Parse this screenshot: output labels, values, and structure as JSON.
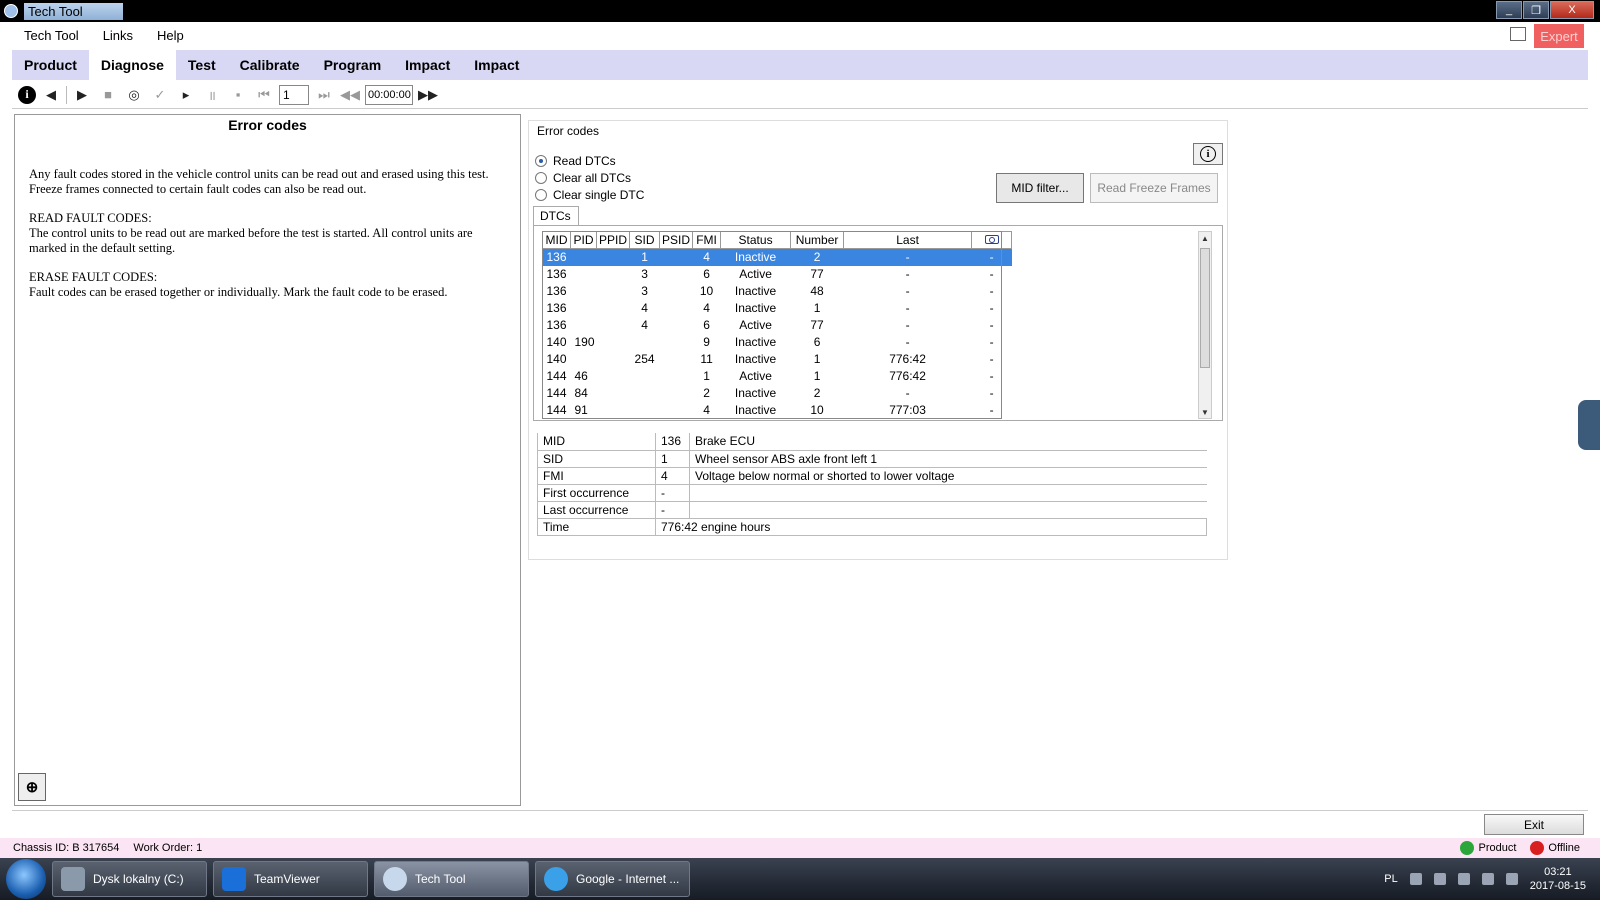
{
  "window": {
    "title": "Tech Tool",
    "controls": [
      "_",
      "❐",
      "X"
    ]
  },
  "menu": {
    "items": [
      "Tech Tool",
      "Links",
      "Help"
    ],
    "expert_label": "Expert"
  },
  "nav": {
    "tabs": [
      "Product",
      "Diagnose",
      "Test",
      "Calibrate",
      "Program",
      "Impact",
      "Impact"
    ],
    "active": "Diagnose"
  },
  "toolbar": {
    "step_value": "1",
    "time_value": "00:00:00"
  },
  "left": {
    "title": "Error codes",
    "p1": "Any fault codes stored in the vehicle control units can be read out and erased using this test. Freeze frames connected to certain fault codes can also be read out.",
    "p2_head": "READ FAULT CODES:",
    "p2": "The control units to be read out are marked before the test is started. All control units are marked in the default setting.",
    "p3_head": "ERASE FAULT CODES:",
    "p3": "Fault codes can be erased together or individually. Mark the fault code to be erased."
  },
  "right": {
    "group_title": "Error codes",
    "radios": [
      "Read DTCs",
      "Clear all DTCs",
      "Clear single DTC"
    ],
    "selected_radio": "Read DTCs",
    "mid_filter": "MID filter...",
    "read_freeze": "Read Freeze Frames",
    "tab": "DTCs",
    "columns": [
      "MID",
      "PID",
      "PPID",
      "SID",
      "PSID",
      "FMI",
      "Status",
      "Number",
      "Last"
    ],
    "rows": [
      [
        "136",
        "",
        "",
        "1",
        "",
        "4",
        "Inactive",
        "2",
        "-",
        "-"
      ],
      [
        "136",
        "",
        "",
        "3",
        "",
        "6",
        "Active",
        "77",
        "-",
        "-"
      ],
      [
        "136",
        "",
        "",
        "3",
        "",
        "10",
        "Inactive",
        "48",
        "-",
        "-"
      ],
      [
        "136",
        "",
        "",
        "4",
        "",
        "4",
        "Inactive",
        "1",
        "-",
        "-"
      ],
      [
        "136",
        "",
        "",
        "4",
        "",
        "6",
        "Active",
        "77",
        "-",
        "-"
      ],
      [
        "140",
        "190",
        "",
        "",
        "",
        "9",
        "Inactive",
        "6",
        "-",
        "-"
      ],
      [
        "140",
        "",
        "",
        "254",
        "",
        "11",
        "Inactive",
        "1",
        "776:42",
        "-"
      ],
      [
        "144",
        "46",
        "",
        "",
        "",
        "1",
        "Active",
        "1",
        "776:42",
        "-"
      ],
      [
        "144",
        "84",
        "",
        "",
        "",
        "2",
        "Inactive",
        "2",
        "-",
        "-"
      ],
      [
        "144",
        "91",
        "",
        "",
        "",
        "4",
        "Inactive",
        "10",
        "777:03",
        "-"
      ]
    ],
    "details": [
      [
        "MID",
        "136",
        "Brake ECU"
      ],
      [
        "SID",
        "1",
        "Wheel sensor ABS axle front left 1"
      ],
      [
        "FMI",
        "4",
        "Voltage below normal or shorted to lower voltage"
      ],
      [
        "First occurrence",
        "-",
        ""
      ],
      [
        "Last occurrence",
        "-",
        ""
      ],
      [
        "Time",
        "776:42 engine hours",
        ""
      ]
    ]
  },
  "exit_label": "Exit",
  "status": {
    "chassis": "Chassis ID: B 317654",
    "work_order": "Work Order: 1",
    "product": "Product",
    "offline": "Offline"
  },
  "taskbar": {
    "tasks": [
      "Dysk lokalny (C:)",
      "TeamViewer",
      "Tech Tool",
      "Google - Internet ..."
    ],
    "lang": "PL",
    "time": "03:21",
    "date": "2017-08-15"
  },
  "colors": {
    "selection": "#3a85e0",
    "nav_bg": "#d8d8f4",
    "status_bg": "#fbe4f3",
    "expert": "#f06060"
  }
}
